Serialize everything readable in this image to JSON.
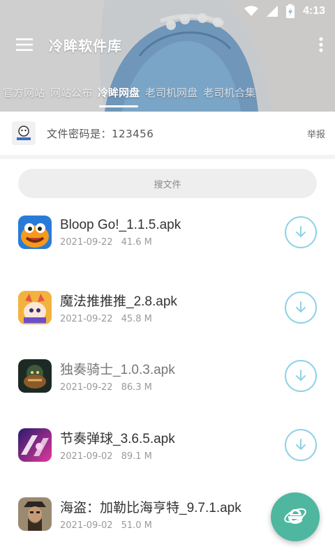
{
  "status_bar": {
    "time": "4:13",
    "icons": [
      "wifi-icon",
      "signal-icon",
      "battery-icon"
    ]
  },
  "toolbar": {
    "title": "冷眸软件库",
    "menu_icon": "hamburger-menu-icon",
    "more_icon": "more-vert-icon"
  },
  "tabs": [
    {
      "label": "官方网站",
      "active": false
    },
    {
      "label": "网站公布",
      "active": false
    },
    {
      "label": "冷眸网盘",
      "active": true
    },
    {
      "label": "老司机网盘",
      "active": false
    },
    {
      "label": "老司机合集",
      "active": false
    }
  ],
  "notice": {
    "text": "文件密码是：123456",
    "report_label": "举报"
  },
  "search": {
    "placeholder": "搜文件"
  },
  "files": [
    {
      "name": "Bloop Go!_1.1.5.apk",
      "date": "2021-09-22",
      "size": "41.6 M",
      "icon": "bloop-go-app-icon"
    },
    {
      "name": "魔法推推推_2.8.apk",
      "date": "2021-09-22",
      "size": "45.8 M",
      "icon": "magic-push-app-icon"
    },
    {
      "name": "独奏骑士_1.0.3.apk",
      "date": "2021-09-22",
      "size": "86.3 M",
      "icon": "solo-knight-app-icon"
    },
    {
      "name": "节奏弹球_3.6.5.apk",
      "date": "2021-09-02",
      "size": "89.1 M",
      "icon": "rhythm-ball-app-icon"
    },
    {
      "name": "海盗：加勒比海亨特_9.7.1.apk",
      "date": "2021-09-02",
      "size": "51.0 M",
      "icon": "pirate-app-icon"
    }
  ],
  "colors": {
    "accent": "#4fb7a0",
    "download_ring": "#8ed2e6"
  }
}
